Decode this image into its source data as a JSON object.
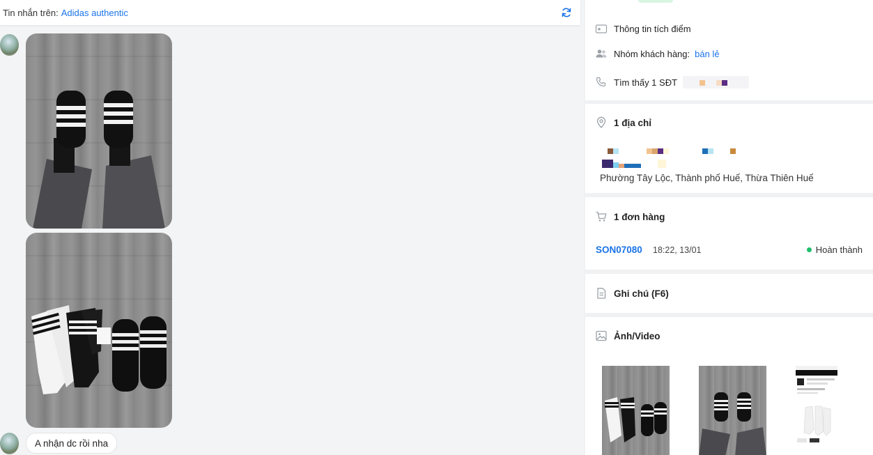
{
  "chat": {
    "header_label": "Tin nhắn trên:",
    "page_name": "Adidas authentic",
    "message_text": "A nhận dc rồi nha"
  },
  "customer": {
    "points_label": "Thông tin tích điểm",
    "group_label": "Nhóm khách hàng:",
    "group_value": "bán lẻ",
    "phone_label": "Tìm thấy 1 SĐT"
  },
  "address": {
    "title": "1 địa chỉ",
    "line": "Phường Tây Lộc, Thành phố Huế, Thừa Thiên Huế"
  },
  "orders": {
    "title": "1 đơn hàng",
    "items": [
      {
        "code": "SON07080",
        "time": "18:22, 13/01",
        "status": "Hoàn thành"
      }
    ]
  },
  "notes": {
    "title": "Ghi chú (F6)"
  },
  "media": {
    "title": "Ảnh/Video"
  },
  "colors": {
    "accent": "#1a73e8",
    "status_done": "#1fbf6b"
  },
  "icons": [
    "refresh-icon",
    "star-card-icon",
    "users-icon",
    "phone-icon",
    "map-pin-icon",
    "cart-icon",
    "note-icon",
    "image-icon"
  ]
}
